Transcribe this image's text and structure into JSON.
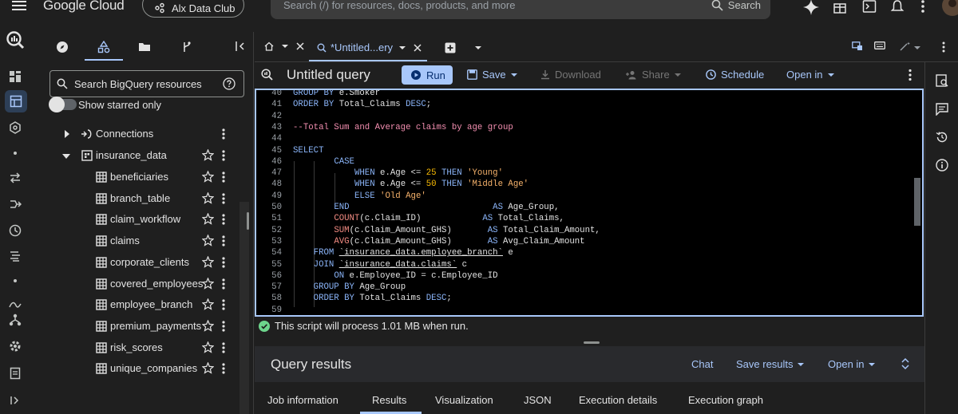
{
  "topbar": {
    "logo": "Google Cloud",
    "project": "Alx Data Club",
    "search_placeholder": "Search (/) for resources, docs, products, and more",
    "search_button": "Search"
  },
  "explorer": {
    "search_placeholder": "Search BigQuery resources",
    "starred_toggle": "Show starred only",
    "connections": "Connections",
    "dataset": "insurance_data",
    "tables": [
      "beneficiaries",
      "branch_table",
      "claim_workflow",
      "claims",
      "corporate_clients",
      "covered_employees",
      "employee_branch",
      "premium_payments",
      "risk_scores",
      "unique_companies"
    ]
  },
  "editor_tabs": {
    "active_tab": "*Untitled...ery"
  },
  "query": {
    "title": "Untitled query",
    "run": "Run",
    "save": "Save",
    "download": "Download",
    "share": "Share",
    "schedule": "Schedule",
    "open_in": "Open in",
    "status": "This script will process 1.01 MB when run."
  },
  "code_lines": [
    {
      "n": "40",
      "html": "<span class=\"kw\">GROUP BY</span> e.Smoker"
    },
    {
      "n": "41",
      "html": "<span class=\"kw\">ORDER BY</span> Total_Claims <span class=\"kw\">DESC</span>;"
    },
    {
      "n": "42",
      "html": ""
    },
    {
      "n": "43",
      "html": "<span class=\"cm\">--Total Sum and Average claims by age group</span>"
    },
    {
      "n": "44",
      "html": ""
    },
    {
      "n": "45",
      "html": "<span class=\"kw\">SELECT</span>"
    },
    {
      "n": "46",
      "html": "        <span class=\"kw\">CASE</span>"
    },
    {
      "n": "47",
      "html": "            <span class=\"kw\">WHEN</span> e.Age &lt;= <span class=\"num\">25</span> <span class=\"kw\">THEN</span> <span class=\"str\">'Young'</span>"
    },
    {
      "n": "48",
      "html": "            <span class=\"kw\">WHEN</span> e.Age &lt;= <span class=\"num\">50</span> <span class=\"kw\">THEN</span> <span class=\"str\">'Middle Age'</span>"
    },
    {
      "n": "49",
      "html": "            <span class=\"kw\">ELSE</span> <span class=\"str\">'Old Age'</span>"
    },
    {
      "n": "50",
      "html": "        <span class=\"kw\">END</span>                            <span class=\"kw\">AS</span> Age_Group,"
    },
    {
      "n": "51",
      "html": "        <span class=\"fn\">COUNT</span>(c.Claim_ID)            <span class=\"kw\">AS</span> Total_Claims,"
    },
    {
      "n": "52",
      "html": "        <span class=\"fn\">SUM</span>(c.Claim_Amount_GHS)       <span class=\"kw\">AS</span> Total_Claim_Amount,"
    },
    {
      "n": "53",
      "html": "        <span class=\"fn\">AVG</span>(c.Claim_Amount_GHS)       <span class=\"kw\">AS</span> Avg_Claim_Amount"
    },
    {
      "n": "54",
      "html": "    <span class=\"kw\">FROM</span> <u>`insurance_data.employee_branch`</u> e"
    },
    {
      "n": "55",
      "html": "    <span class=\"kw\">JOIN</span> <u>`insurance_data.claims`</u> c"
    },
    {
      "n": "56",
      "html": "        <span class=\"kw\">ON</span> e.Employee_ID = c.Employee_ID"
    },
    {
      "n": "57",
      "html": "    <span class=\"kw\">GROUP BY</span> Age_Group"
    },
    {
      "n": "58",
      "html": "    <span class=\"kw\">ORDER BY</span> Total_Claims <span class=\"kw\">DESC</span>;"
    },
    {
      "n": "59",
      "html": ""
    }
  ],
  "results": {
    "title": "Query results",
    "chat": "Chat",
    "save_results": "Save results",
    "open_in": "Open in",
    "tabs": [
      "Job information",
      "Results",
      "Visualization",
      "JSON",
      "Execution details",
      "Execution graph"
    ]
  }
}
